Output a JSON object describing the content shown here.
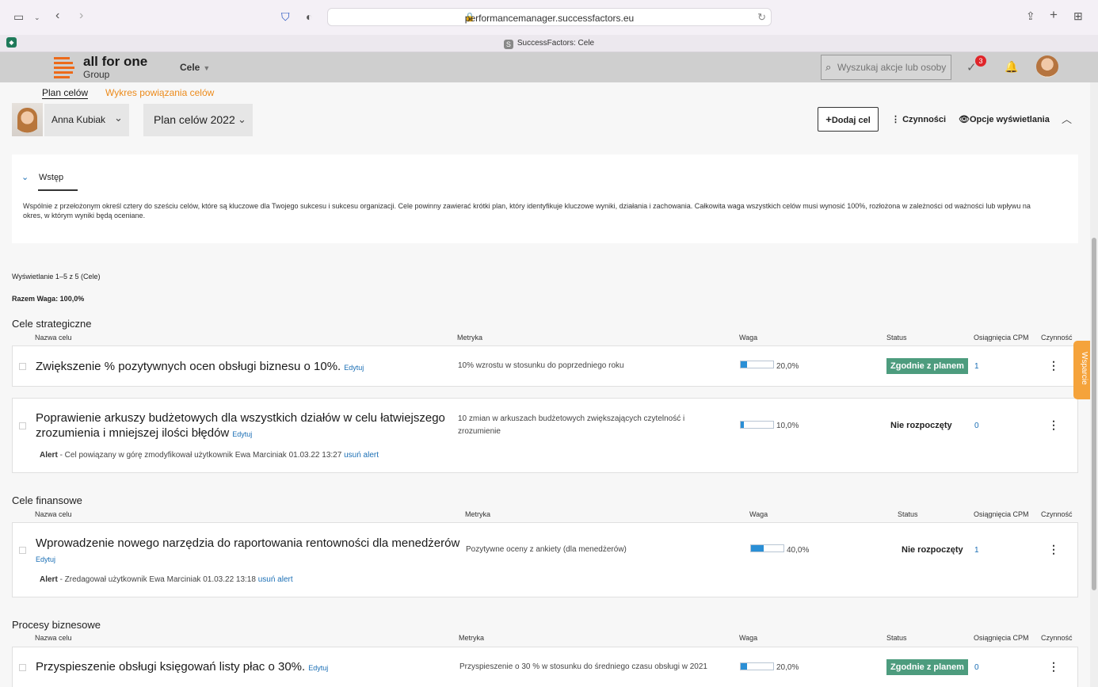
{
  "browser": {
    "url": "performancemanager.successfactors.eu",
    "tab_title": "SuccessFactors: Cele",
    "tab_favicon": "S"
  },
  "header": {
    "logo_line1": "all for one",
    "logo_line2": "Group",
    "module": "Cele",
    "search_placeholder": "Wyszukaj akcje lub osoby",
    "notification_count": "3"
  },
  "subnav": {
    "plan": "Plan celów",
    "chart": "Wykres powiązania celów"
  },
  "toolbar": {
    "user": "Anna Kubiak",
    "plan": "Plan celów 2022",
    "add": "Dodaj cel",
    "actions": "Czynności",
    "display": "Opcje wyświetlania"
  },
  "intro": {
    "tab": "Wstęp",
    "text": "Wspólnie z przełożonym określ cztery do sześciu celów, które są kluczowe dla Twojego sukcesu i sukcesu organizacji. Cele powinny zawierać krótki plan, który identyfikuje kluczowe wyniki, działania i zachowania. Całkowita waga wszystkich celów musi wynosić 100%, rozłożona w zależności od ważności lub wpływu na okres, w którym wyniki będą oceniane."
  },
  "meta": {
    "display": "Wyświetlanie 1–5 z 5 (Cele)",
    "total": "Razem Waga: 100,0%"
  },
  "columns": {
    "name": "Nazwa celu",
    "metric": "Metryka",
    "weight": "Waga",
    "status": "Status",
    "cpm": "Osiągnięcia CPM",
    "actions": "Czynność"
  },
  "edit_label": "Edytuj",
  "alert_label": "Alert",
  "alert_remove": "usuń alert",
  "sections": [
    {
      "title": "Cele strategiczne",
      "goals": [
        {
          "name": "Zwiększenie % pozytywnych ocen obsługi biznesu o 10%.",
          "metric": "10% wzrostu w stosunku do poprzedniego roku",
          "weight": "20,0%",
          "weight_fraction": 0.2,
          "status": "Zgodnie z planem",
          "cpm": "1"
        },
        {
          "name": "Poprawienie arkuszy budżetowych dla wszystkich działów w celu łatwiejszego zrozumienia i mniejszej ilości błędów",
          "metric": "10 zmian w arkuszach budżetowych zwiększających czytelność i zrozumienie",
          "weight": "10,0%",
          "weight_fraction": 0.1,
          "status": "Nie rozpoczęty",
          "cpm": "0",
          "alert": "- Cel powiązany w górę zmodyfikował użytkownik Ewa Marciniak 01.03.22 13:27"
        }
      ]
    },
    {
      "title": "Cele finansowe",
      "goals": [
        {
          "name": "Wprowadzenie nowego narzędzia do raportowania rentowności dla menedżerów",
          "metric": "Pozytywne oceny z ankiety (dla menedżerów)",
          "weight": "40,0%",
          "weight_fraction": 0.4,
          "status": "Nie rozpoczęty",
          "cpm": "1",
          "alert": "- Zredagował użytkownik Ewa Marciniak 01.03.22 13:18"
        }
      ]
    },
    {
      "title": "Procesy biznesowe",
      "goals": [
        {
          "name": "Przyspieszenie obsługi księgowań listy płac o 30%.",
          "metric": "Przyspieszenie o 30 % w stosunku do średniego czasu obsługi w 2021",
          "weight": "20,0%",
          "weight_fraction": 0.2,
          "status": "Zgodnie z planem",
          "cpm": "0"
        }
      ]
    }
  ],
  "support": "Wsparcie"
}
